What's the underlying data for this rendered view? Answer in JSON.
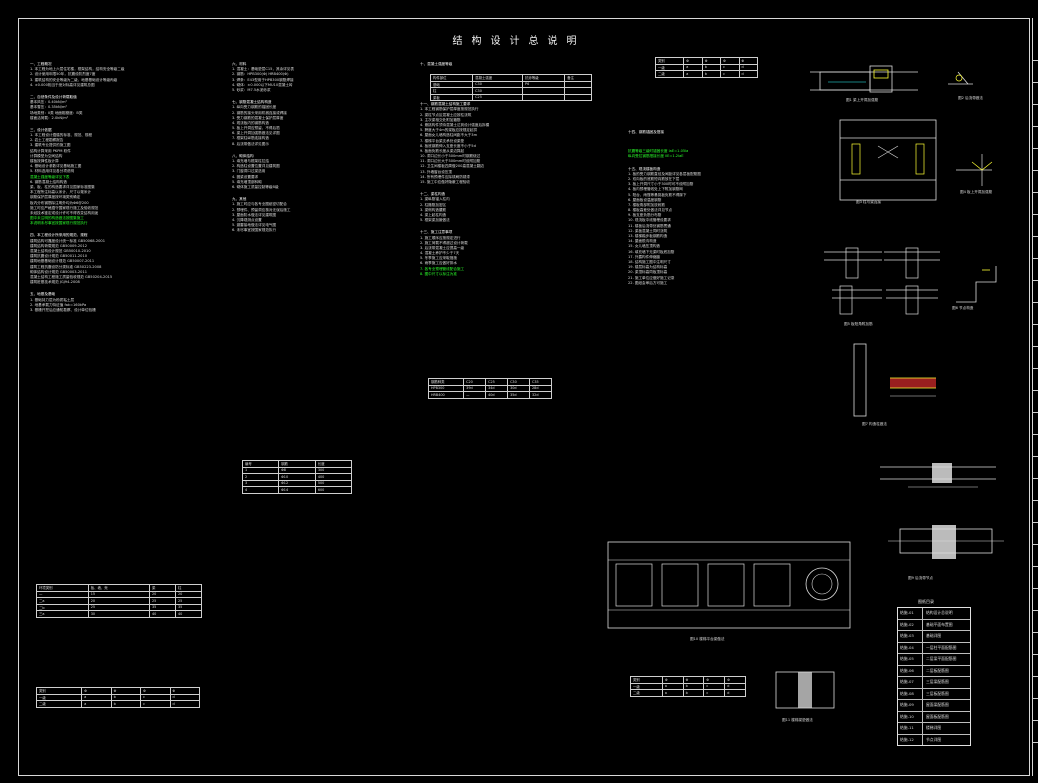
{
  "title": "结构设计总说明",
  "columns": [
    {
      "lines": [
        {
          "t": "一、工程概况",
          "k": "h"
        },
        {
          "t": "1. 本工程为地上六层住宅楼，框架结构，结构安全等级二级",
          "k": ""
        },
        {
          "t": "2. 设计使用年限50年，抗震设防烈度7度",
          "k": ""
        },
        {
          "t": "3. 建筑结构的安全等级为二级，地基基础设计等级丙级",
          "k": ""
        },
        {
          "t": "4. ±0.000相当于绝对标高详见建筑总图",
          "k": ""
        },
        {
          "t": "",
          "k": "gap"
        },
        {
          "t": "二、自然条件及设计荷载取值",
          "k": "h"
        },
        {
          "t": "基本风压：0.40kN/m²",
          "k": ""
        },
        {
          "t": "基本雪压：0.35kN/m²",
          "k": ""
        },
        {
          "t": "场地类别：II类  地面粗糙度：B类",
          "k": ""
        },
        {
          "t": "楼面活荷载：2.0kN/m²",
          "k": ""
        },
        {
          "t": "",
          "k": "gap"
        },
        {
          "t": "三、设计依据",
          "k": "h"
        },
        {
          "t": "1. 本工程设计遵循的标准、规范、规程",
          "k": ""
        },
        {
          "t": "2. 岩土工程勘察报告",
          "k": ""
        },
        {
          "t": "3. 建筑专业提供的施工图",
          "k": ""
        },
        {
          "t": "  结构计算采用 PKPM 软件",
          "k": ""
        },
        {
          "t": "  计算模型为空间结构",
          "k": ""
        },
        {
          "t": "  楼板按弹性板计算",
          "k": ""
        },
        {
          "t": "4. 基础设计参数详见基础施工图",
          "k": ""
        },
        {
          "t": "5. 材料选用详见各分项说明",
          "k": ""
        },
        {
          "t": "  混凝土强度等级详见下表",
          "k": "g"
        },
        {
          "t": "6. 钢筋混凝土结构构造",
          "k": ""
        },
        {
          "t": "  梁、板、柱的构造要求详见国家标准图集",
          "k": ""
        },
        {
          "t": "  本工程所注标高以米计，尺寸以毫米计",
          "k": ""
        },
        {
          "t": "  钢筋保护层厚度按环境类别确定",
          "k": ""
        },
        {
          "t": "  板内分布钢筋除注明外均为Φ6@200",
          "k": ""
        },
        {
          "t": "  施工时应严格遵守国家现行施工及验收规范",
          "k": ""
        },
        {
          "t": "  未经技术鉴定或设计许可不得改变结构用途",
          "k": ""
        },
        {
          "t": "  图中未注明的构造做法按图集施工",
          "k": "g"
        },
        {
          "t": "  本说明未尽事宜按国家现行规范执行",
          "k": "g"
        },
        {
          "t": "",
          "k": "gap"
        },
        {
          "t": "四、本工程设计所采用的规范、规程",
          "k": "h"
        },
        {
          "t": "建筑结构可靠度设计统一标准           GB50068-2001",
          "k": ""
        },
        {
          "t": "建筑结构荷载规范                     GB50009-2012",
          "k": ""
        },
        {
          "t": "混凝土结构设计规范                   GB50010-2010",
          "k": ""
        },
        {
          "t": "建筑抗震设计规范                     GB50011-2010",
          "k": ""
        },
        {
          "t": "建筑地基基础设计规范                 GB50007-2011",
          "k": ""
        },
        {
          "t": "建筑工程抗震设防分类标准             GB50223-2008",
          "k": ""
        },
        {
          "t": "砌体结构设计规范                     GB50003-2011",
          "k": ""
        },
        {
          "t": "混凝土结构工程施工质量验收规范       GB50204-2015",
          "k": ""
        },
        {
          "t": "建筑桩基技术规范                     JGJ94-2008",
          "k": ""
        },
        {
          "t": "",
          "k": "gap"
        },
        {
          "t": "五、地基及基础",
          "k": "h"
        },
        {
          "t": "1. 基础持力层为粉质粘土层",
          "k": ""
        },
        {
          "t": "2. 地基承载力特征值 fak=160kPa",
          "k": ""
        },
        {
          "t": "3. 基槽开挖后应通知勘察、设计单位验槽",
          "k": ""
        }
      ]
    },
    {
      "lines": [
        {
          "t": "六、材料",
          "k": "h"
        },
        {
          "t": "1. 混凝土：基础垫层C15，其余详见表",
          "k": ""
        },
        {
          "t": "2. 钢筋：HPB300(Φ) HRB400(Φ)",
          "k": ""
        },
        {
          "t": "3. 焊条：E43型用于HPB300钢筋焊接",
          "k": ""
        },
        {
          "t": "4. 砌体：±0.000以下MU10混凝土砖",
          "k": ""
        },
        {
          "t": "5. 砂浆：M7.5水泥砂浆",
          "k": ""
        },
        {
          "t": "",
          "k": "gap"
        },
        {
          "t": "七、钢筋混凝土结构构造",
          "k": "h"
        },
        {
          "t": "1. 纵向受力钢筋的锚固长度",
          "k": ""
        },
        {
          "t": "2. 钢筋的接头采用机械连接或焊接",
          "k": ""
        },
        {
          "t": "3. 受力钢筋的混凝土保护层厚度",
          "k": ""
        },
        {
          "t": "4. 现浇板内的钢筋构造",
          "k": ""
        },
        {
          "t": "5. 板上开洞应预留，不得后凿",
          "k": ""
        },
        {
          "t": "6. 梁上开洞加强筋做法见详图",
          "k": ""
        },
        {
          "t": "7. 框架柱纵筋连接构造",
          "k": ""
        },
        {
          "t": "8. 后浇带做法详见图示",
          "k": ""
        },
        {
          "t": "",
          "k": "gap"
        },
        {
          "t": "八、砌体结构",
          "k": "h"
        },
        {
          "t": "1. 填充墙与框架柱拉结",
          "k": ""
        },
        {
          "t": "2. 构造柱设置位置详见建筑图",
          "k": ""
        },
        {
          "t": "3. 门窗洞口过梁选用",
          "k": ""
        },
        {
          "t": "4. 圈梁设置要求",
          "k": ""
        },
        {
          "t": "5. 填充墙顶部斜砌",
          "k": ""
        },
        {
          "t": "6. 砌体施工质量控制等级B级",
          "k": ""
        },
        {
          "t": "",
          "k": "gap"
        },
        {
          "t": "九、其他",
          "k": "h"
        },
        {
          "t": "1. 施工时应与各专业图纸密切配合",
          "k": ""
        },
        {
          "t": "2. 预埋件、预留洞应核对无误后施工",
          "k": ""
        },
        {
          "t": "3. 屋面防水做法详见建筑图",
          "k": ""
        },
        {
          "t": "4. 沉降观测点设置",
          "k": ""
        },
        {
          "t": "5. 避雷接地做法详见电气图",
          "k": ""
        },
        {
          "t": "6. 未尽事宜按国家规范执行",
          "k": ""
        }
      ]
    },
    {
      "lines": [
        {
          "t": "十、混凝土强度等级",
          "k": "h"
        },
        {
          "t": "",
          "k": "gap"
        },
        {
          "t": "",
          "k": "gap"
        },
        {
          "t": "",
          "k": "gap"
        },
        {
          "t": "",
          "k": "gap"
        },
        {
          "t": "",
          "k": "gap"
        },
        {
          "t": "十一、钢筋混凝土结构施工要求",
          "k": "h"
        },
        {
          "t": "1. 本工程钢筋保护层厚度按规范执行",
          "k": ""
        },
        {
          "t": "2. 梁柱节点区混凝土应按柱浇筑",
          "k": ""
        },
        {
          "t": "3. 主次梁相交处附加箍筋",
          "k": ""
        },
        {
          "t": "4. 悬挑构件须待混凝土达到设计强度后拆模",
          "k": ""
        },
        {
          "t": "5. 跨度大于4m的梁板应按规定起拱",
          "k": ""
        },
        {
          "t": "6. 屋面女儿墙构造柱间距不大于3m",
          "k": ""
        },
        {
          "t": "7. 楼梯平台梁支承处设梁垫",
          "k": ""
        },
        {
          "t": "8. 板底钢筋伸入支座长度不小于5d",
          "k": ""
        },
        {
          "t": "9. 板面负筋长度从梁边算起",
          "k": ""
        },
        {
          "t": "10. 洞口边长小于300mm时钢筋绕过",
          "k": ""
        },
        {
          "t": "11. 洞口边长大于300mm时设附加筋",
          "k": ""
        },
        {
          "t": "12. 卫生间楼板四周做200高混凝土翻边",
          "k": ""
        },
        {
          "t": "13. 外墙窗台设压顶",
          "k": ""
        },
        {
          "t": "14. 所有预埋件应除锈刷防锈漆",
          "k": ""
        },
        {
          "t": "15. 施工中应做好隐蔽工程验收",
          "k": ""
        },
        {
          "t": "",
          "k": "gap"
        },
        {
          "t": "十二、梁柱构造",
          "k": "h"
        },
        {
          "t": "1. 梁纵筋锚入柱内",
          "k": ""
        },
        {
          "t": "2. 柱箍筋加密区",
          "k": ""
        },
        {
          "t": "3. 梁侧构造腰筋",
          "k": ""
        },
        {
          "t": "4. 梁上起柱构造",
          "k": ""
        },
        {
          "t": "5. 框架梁加腋做法",
          "k": ""
        },
        {
          "t": "",
          "k": "gap"
        },
        {
          "t": "十三、施工注意事项",
          "k": "h"
        },
        {
          "t": "1. 施工顺序应按规定进行",
          "k": ""
        },
        {
          "t": "2. 施工荷载不得超过设计荷载",
          "k": ""
        },
        {
          "t": "3. 后浇带混凝土应提高一级",
          "k": ""
        },
        {
          "t": "4. 混凝土养护不少于7天",
          "k": ""
        },
        {
          "t": "5. 冬季施工应采取措施",
          "k": ""
        },
        {
          "t": "6. 雨季施工应做好排水",
          "k": ""
        },
        {
          "t": "7. 各专业预埋管线配合施工",
          "k": "g"
        },
        {
          "t": "8. 图中尺寸以标注为准",
          "k": "g"
        }
      ]
    },
    {
      "lines": [
        {
          "t": "十四、钢筋锚固及搭接",
          "k": "h"
        },
        {
          "t": "",
          "k": "gap"
        },
        {
          "t": "",
          "k": "gap"
        },
        {
          "t": "  抗震等级三级时锚固长度 laE=1.05la",
          "k": "g"
        },
        {
          "t": "  纵向受拉钢筋搭接长度 llE=1.2laE",
          "k": "g"
        },
        {
          "t": "",
          "k": "gap"
        },
        {
          "t": "十五、现浇楼板构造",
          "k": "h"
        },
        {
          "t": "1. 板的受力钢筋直径及间距详见各层板配筋图",
          "k": ""
        },
        {
          "t": "2. 双向板的底筋短向筋放在下层",
          "k": ""
        },
        {
          "t": "3. 板上开洞尺寸小于300时可不设附加筋",
          "k": ""
        },
        {
          "t": "4. 板内预埋管线处上下附加钢筋网",
          "k": ""
        },
        {
          "t": "5. 阳台、雨篷等悬挑板负筋不得踩下",
          "k": ""
        },
        {
          "t": "6. 屋面板设温度钢筋",
          "k": ""
        },
        {
          "t": "7. 楼板角部附加放射筋",
          "k": ""
        },
        {
          "t": "8. 楼板高差处做法详见节点",
          "k": ""
        },
        {
          "t": "9. 板支座负筋分布筋",
          "k": ""
        },
        {
          "t": "10. 现浇板中线管埋设要求",
          "k": ""
        },
        {
          "t": "11. 楼板后浇带处钢筋贯通",
          "k": ""
        },
        {
          "t": "12. 梁板混凝土同时浇筑",
          "k": ""
        },
        {
          "t": "13. 楼梯踏步板钢筋构造",
          "k": ""
        },
        {
          "t": "14. 屋面檐沟构造",
          "k": ""
        },
        {
          "t": "15. 女儿墙压顶构造",
          "k": ""
        },
        {
          "t": "16. 填充墙下无梁时板底加筋",
          "k": ""
        },
        {
          "t": "17. 外露构件伸缩缝",
          "k": ""
        },
        {
          "t": "18. 结构施工图中注明尺寸",
          "k": ""
        },
        {
          "t": "19. 楼层标高为结构标高",
          "k": ""
        },
        {
          "t": "20. 梁顶标高同板顶标高",
          "k": ""
        },
        {
          "t": "21. 施工单位应做好施工记录",
          "k": ""
        },
        {
          "t": "22. 图纸会审后方可施工",
          "k": ""
        }
      ]
    }
  ],
  "tables": {
    "concrete": {
      "head": [
        "构件部位",
        "混凝土强度",
        "抗渗等级",
        "备注"
      ],
      "rows": [
        [
          "基础",
          "C30",
          "P6",
          ""
        ],
        [
          "柱",
          "C30",
          "",
          ""
        ],
        [
          "梁板",
          "C25",
          "",
          ""
        ]
      ]
    },
    "cover": {
      "head": [
        "环境类别",
        "板、墙、壳",
        "梁",
        "柱"
      ],
      "rows": [
        [
          "一",
          "15",
          "20",
          "20"
        ],
        [
          "二a",
          "20",
          "25",
          "25"
        ],
        [
          "二b",
          "25",
          "35",
          "35"
        ],
        [
          "三a",
          "30",
          "40",
          "40"
        ]
      ]
    },
    "anchor": {
      "head": [
        "钢筋种类",
        "C20",
        "C25",
        "C30",
        "C35"
      ],
      "rows": [
        [
          "HPB300",
          "39d",
          "34d",
          "30d",
          "28d"
        ],
        [
          "HRB400",
          "—",
          "40d",
          "35d",
          "32d"
        ]
      ]
    },
    "small": {
      "head": [
        "类别",
        "Φ",
        "Φ",
        "Φ",
        "Φ"
      ],
      "rows": [
        [
          "一级",
          "a",
          "b",
          "c",
          "d"
        ],
        [
          "二级",
          "a",
          "b",
          "c",
          "d"
        ]
      ]
    },
    "lap": {
      "head": [
        "编号",
        "钢筋",
        "长度"
      ],
      "rows": [
        [
          "1",
          "Φ8",
          "300"
        ],
        [
          "2",
          "Φ10",
          "400"
        ],
        [
          "3",
          "Φ12",
          "500"
        ],
        [
          "4",
          "Φ14",
          "600"
        ]
      ]
    }
  },
  "legend": {
    "title": "图纸目录",
    "rows": [
      [
        "结施-01",
        "结构设计总说明"
      ],
      [
        "结施-02",
        "基础平面布置图"
      ],
      [
        "结施-03",
        "基础详图"
      ],
      [
        "结施-04",
        "一层柱平面配筋图"
      ],
      [
        "结施-05",
        "二层梁平面配筋图"
      ],
      [
        "结施-06",
        "二层板配筋图"
      ],
      [
        "结施-07",
        "三层梁配筋图"
      ],
      [
        "结施-08",
        "三层板配筋图"
      ],
      [
        "结施-09",
        "屋面梁配筋图"
      ],
      [
        "结施-10",
        "屋面板配筋图"
      ],
      [
        "结施-11",
        "楼梯详图"
      ],
      [
        "结施-12",
        "节点详图"
      ]
    ]
  },
  "captions": {
    "c1": "图1 梁上开洞加强筋",
    "c2": "图2 后浇带做法",
    "c3": "图3 柱与梁连接",
    "c4": "图4 板上开洞加强筋",
    "c5": "图5 板阳角附加筋",
    "c6": "图6 节点构造",
    "c7": "图7 构造柱做法",
    "c8": "图8 梁腰筋构造",
    "c9": "图9 后浇带节点",
    "c10": "图10 楼梯平台梁做法",
    "c11": "图11 楼梯梁垫做法"
  },
  "colors": {
    "bg": "#000000",
    "line": "#dcdcdc",
    "green": "#2aff2a",
    "yellow": "#ffff33",
    "red": "#ff3333",
    "cyan": "#33ffff"
  }
}
